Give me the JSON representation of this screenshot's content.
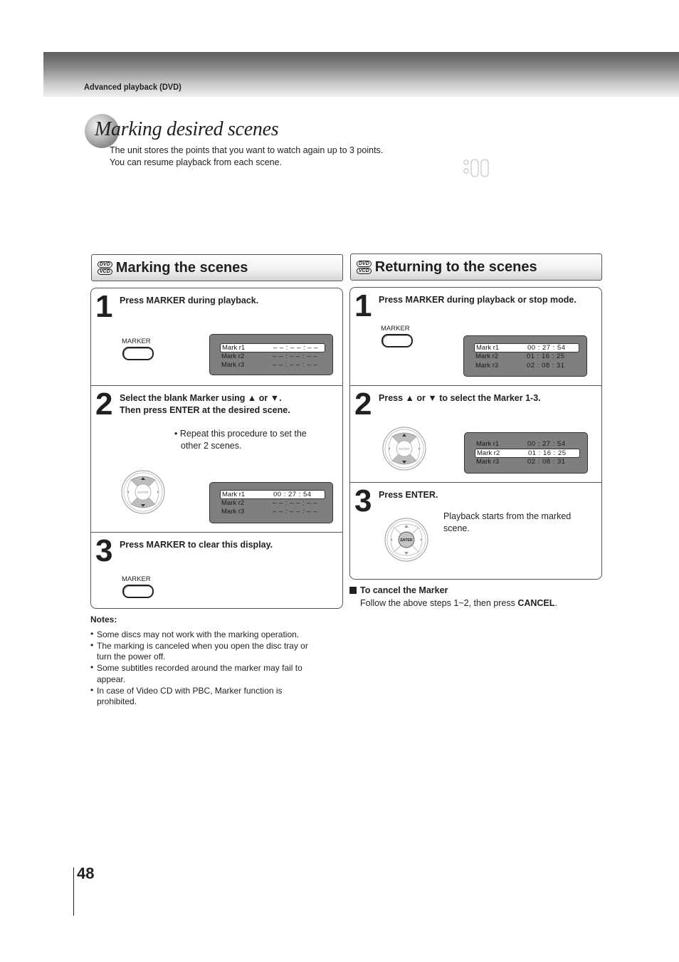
{
  "header": {
    "section_label": "Advanced playback (DVD)"
  },
  "title": {
    "text": "Marking desired scenes",
    "intro_lines": [
      "The unit stores the points that you want to watch again up to 3 points.",
      "You can resume playback from each scene."
    ]
  },
  "disc_badges": [
    "DVD",
    "VCD"
  ],
  "left": {
    "heading": "Marking the scenes",
    "steps": [
      {
        "num": "1",
        "text": "Press MARKER during playback.",
        "button_label": "MARKER",
        "osd": [
          {
            "label": "Mark  r1",
            "value": "– – : – – : – –",
            "selected": true
          },
          {
            "label": "Mark  r2",
            "value": "– – : – – : – –",
            "selected": false
          },
          {
            "label": "Mark  r3",
            "value": "– – : – – : – –",
            "selected": false
          }
        ]
      },
      {
        "num": "2",
        "text_lines": [
          "Select the blank Marker using ▲ or ▼.",
          "Then press ENTER at the desired scene."
        ],
        "bullet": "• Repeat this procedure to set the",
        "bullet_cont": "other 2 scenes.",
        "enter_label": "ENTER",
        "osd": [
          {
            "label": "Mark  r1",
            "value": "00 : 27 : 54",
            "selected": true
          },
          {
            "label": "Mark  r2",
            "value": "– – : – – : – –",
            "selected": false
          },
          {
            "label": "Mark  r3",
            "value": "– – : – – : – –",
            "selected": false
          }
        ]
      },
      {
        "num": "3",
        "text": "Press MARKER to clear this display.",
        "button_label": "MARKER"
      }
    ],
    "notes": {
      "heading": "Notes:",
      "items": [
        [
          "Some discs may not work with the marking operation."
        ],
        [
          "The marking is canceled when you open the disc tray or",
          "turn the power off."
        ],
        [
          "Some subtitles recorded around the marker may fail to",
          "appear."
        ],
        [
          "In case of Video CD with PBC, Marker function is",
          "prohibited."
        ]
      ]
    }
  },
  "right": {
    "heading": "Returning to the scenes",
    "steps": [
      {
        "num": "1",
        "text": "Press MARKER during playback or stop mode.",
        "button_label": "MARKER",
        "osd": [
          {
            "label": "Mark  r1",
            "value": "00 : 27 : 54",
            "selected": true
          },
          {
            "label": "Mark  r2",
            "value": "01 : 16 : 25",
            "selected": false
          },
          {
            "label": "Mark  r3",
            "value": "02 : 08 : 31",
            "selected": false
          }
        ]
      },
      {
        "num": "2",
        "text": "Press ▲ or ▼ to select the Marker 1-3.",
        "enter_label": "ENTER",
        "osd": [
          {
            "label": "Mark  r1",
            "value": "00 : 27 : 54",
            "selected": false
          },
          {
            "label": "Mark  r2",
            "value": "01 : 16 : 25",
            "selected": true
          },
          {
            "label": "Mark  r3",
            "value": "02 : 08 : 31",
            "selected": false
          }
        ]
      },
      {
        "num": "3",
        "text": "Press ENTER.",
        "enter_label": "ENTER",
        "desc_lines": [
          "Playback starts from the marked",
          "scene."
        ]
      }
    ],
    "cancel": {
      "heading": "To cancel the Marker",
      "text_before": "Follow the above steps 1~2, then press ",
      "text_bold": "CANCEL",
      "text_after": "."
    }
  },
  "page_number": "48"
}
